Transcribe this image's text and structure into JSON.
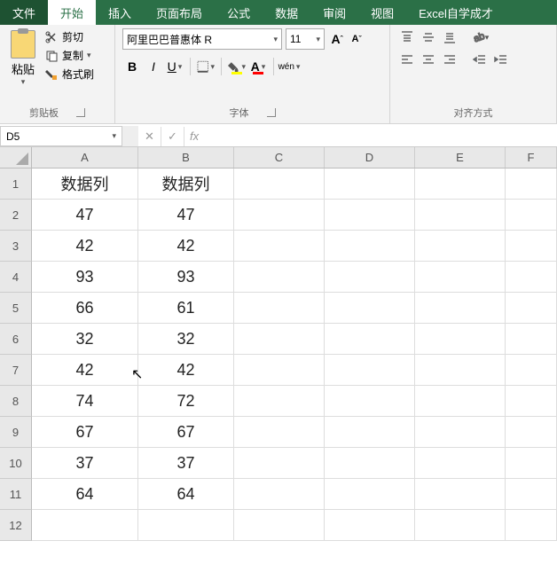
{
  "menu": {
    "file": "文件",
    "home": "开始",
    "insert": "插入",
    "layout": "页面布局",
    "formula": "公式",
    "data": "数据",
    "review": "审阅",
    "view": "视图",
    "custom": "Excel自学成才"
  },
  "ribbon": {
    "clipboard": {
      "paste": "粘贴",
      "cut": "剪切",
      "copy": "复制",
      "painter": "格式刷",
      "label": "剪贴板"
    },
    "font": {
      "name": "阿里巴巴普惠体 R",
      "size": "11",
      "label": "字体",
      "wen": "wén"
    },
    "align": {
      "label": "对齐方式"
    }
  },
  "namebox": "D5",
  "colWidths": {
    "A": 120,
    "B": 108,
    "C": 102,
    "D": 102,
    "E": 102,
    "F": 58
  },
  "cols": [
    "A",
    "B",
    "C",
    "D",
    "E",
    "F"
  ],
  "rows": [
    1,
    2,
    3,
    4,
    5,
    6,
    7,
    8,
    9,
    10,
    11,
    12
  ],
  "chart_data": {
    "type": "table",
    "title": "",
    "headers": [
      "数据列",
      "数据列"
    ],
    "data": [
      [
        47,
        47
      ],
      [
        42,
        42
      ],
      [
        93,
        93
      ],
      [
        66,
        61
      ],
      [
        32,
        32
      ],
      [
        42,
        42
      ],
      [
        74,
        72
      ],
      [
        67,
        67
      ],
      [
        37,
        37
      ],
      [
        64,
        64
      ]
    ]
  }
}
